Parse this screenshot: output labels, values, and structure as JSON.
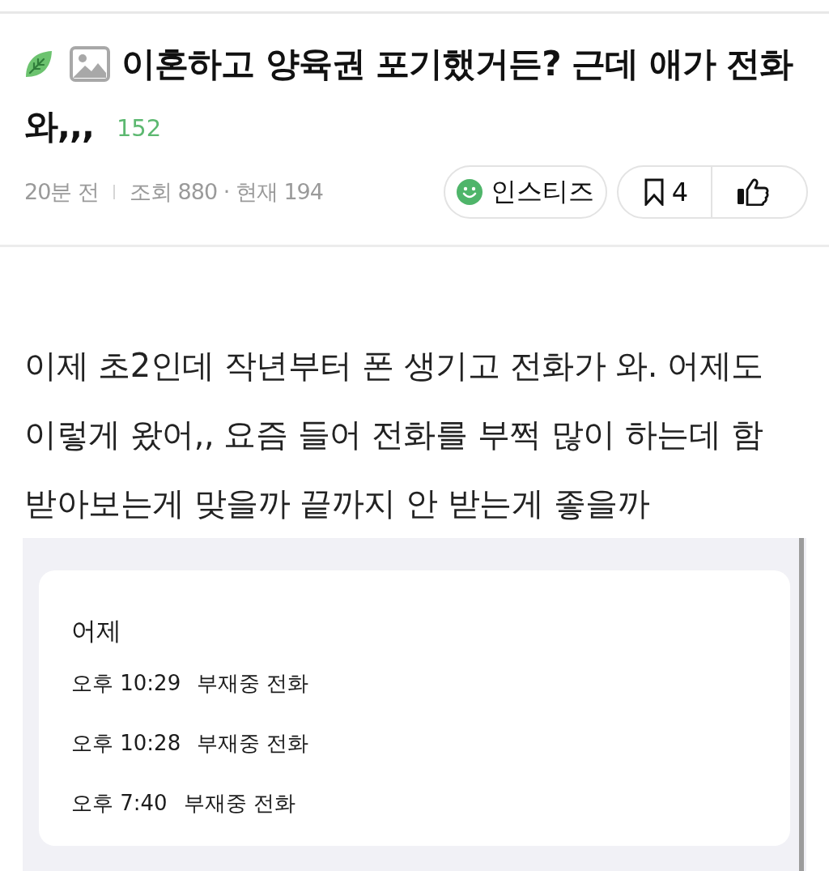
{
  "post": {
    "title_lines": [
      "이혼하고 양육권 포기했거든? 근데 애가 전화",
      "와,,,"
    ],
    "comment_count": "152",
    "time": "20분 전",
    "views": "조회 880 · 현재 194",
    "source_button": "인스티즈",
    "bookmark_count": "4"
  },
  "body": "이제 초2인데 작년부터 폰 생기고 전화가 와. 어제도 이렇게 왔어,, 요즘 들어 전화를 부쩍 많이 하는데 함 받아보는게 맞을까 끝까지 안 받는게 좋을까",
  "inset": {
    "section": "어제",
    "calls": [
      {
        "time": "오후 10:29",
        "label": "부재중 전화"
      },
      {
        "time": "오후 10:28",
        "label": "부재중 전화"
      },
      {
        "time": "오후 7:40",
        "label": "부재중 전화"
      }
    ]
  }
}
